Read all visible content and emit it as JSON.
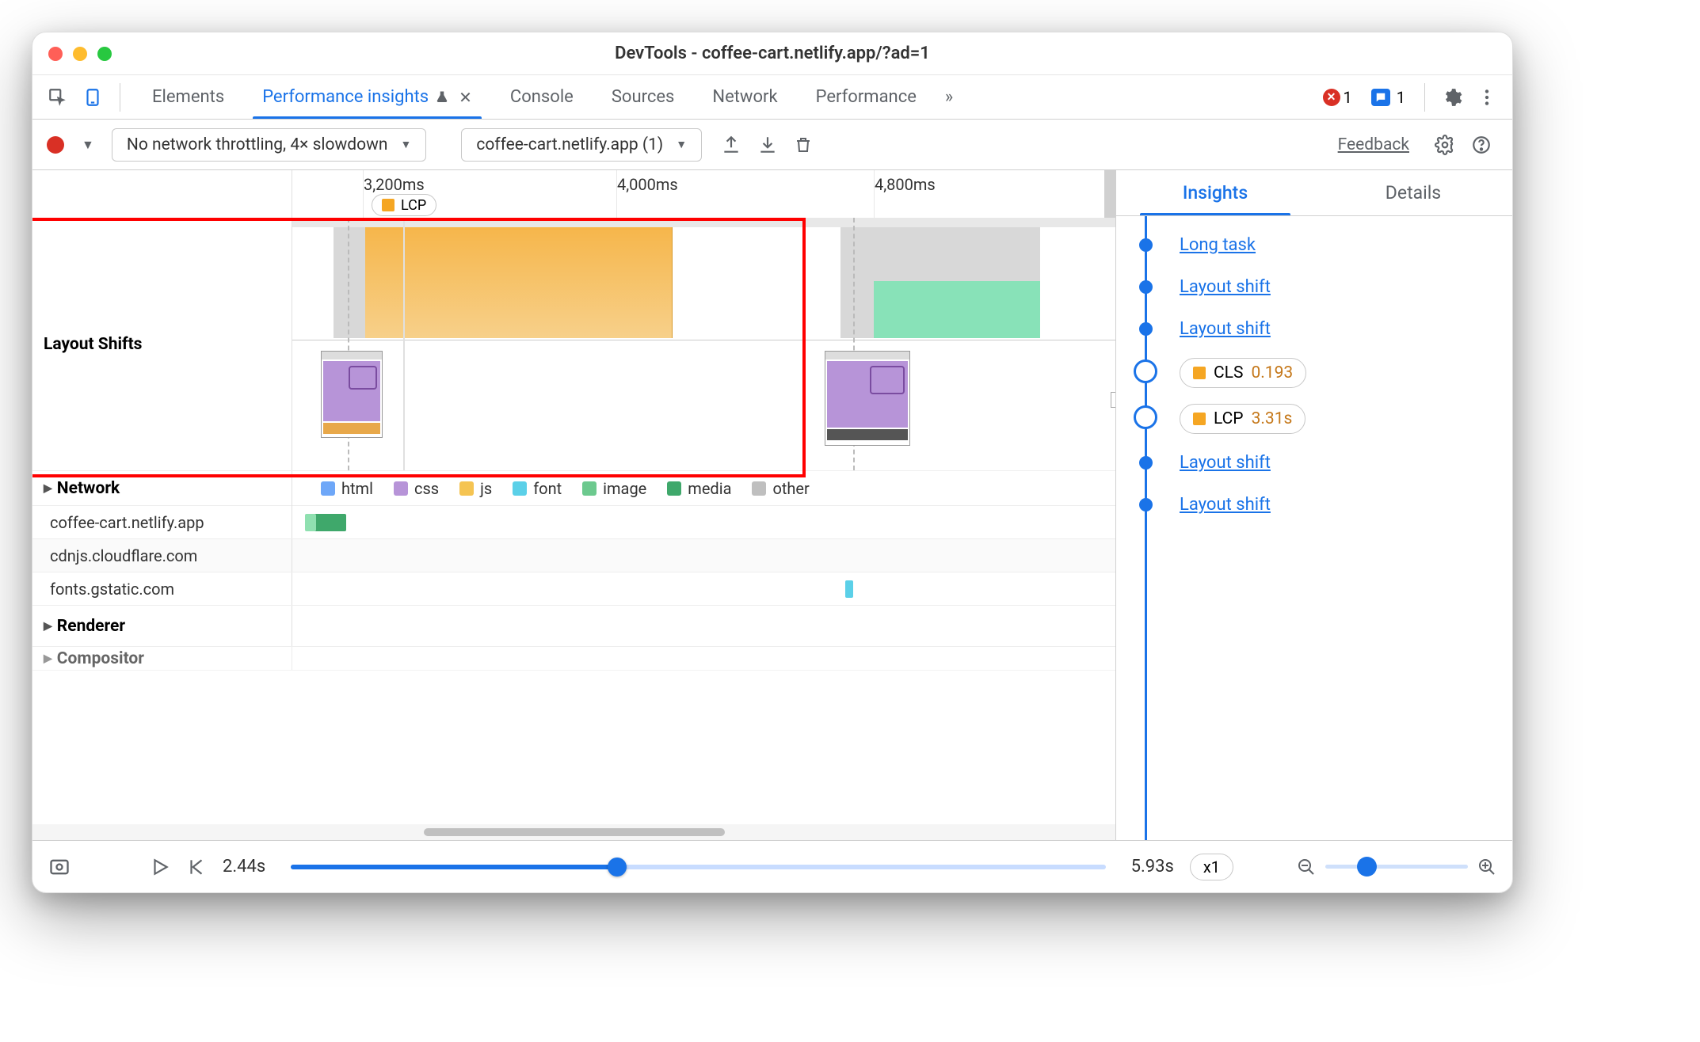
{
  "window": {
    "title": "DevTools - coffee-cart.netlify.app/?ad=1"
  },
  "main_tabs": {
    "elements": "Elements",
    "active": "Performance insights",
    "console": "Console",
    "sources": "Sources",
    "network": "Network",
    "performance": "Performance"
  },
  "status": {
    "errors": "1",
    "messages": "1"
  },
  "toolbar": {
    "throttling": "No network throttling, 4× slowdown",
    "recording": "coffee-cart.netlify.app (1)",
    "feedback": "Feedback"
  },
  "ruler": {
    "t1": "3,200ms",
    "t2": "4,000ms",
    "t3": "4,800ms",
    "lcp": "LCP"
  },
  "tracks": {
    "layout_shifts": "Layout Shifts",
    "network": "Network",
    "renderer": "Renderer",
    "compositor": "Compositor"
  },
  "legend": {
    "html": "html",
    "css": "css",
    "js": "js",
    "font": "font",
    "image": "image",
    "media": "media",
    "other": "other"
  },
  "network_rows": {
    "r1": "coffee-cart.netlify.app",
    "r2": "cdnjs.cloudflare.com",
    "r3": "fonts.gstatic.com"
  },
  "insights": {
    "tab_insights": "Insights",
    "tab_details": "Details",
    "long_task": "Long task",
    "layout_shift": "Layout shift",
    "cls_label": "CLS",
    "cls_value": "0.193",
    "lcp_label": "LCP",
    "lcp_value": "3.31s"
  },
  "footer": {
    "start": "2.44s",
    "end": "5.93s",
    "speed": "x1"
  },
  "colors": {
    "html": "#6ea7f8",
    "css": "#b794d8",
    "js": "#f5c452",
    "font": "#5bd0e8",
    "image": "#6cc98e",
    "media": "#3fa86b",
    "other": "#bfbfbf",
    "orange": "#f5a623",
    "blue": "#1a73e8"
  }
}
